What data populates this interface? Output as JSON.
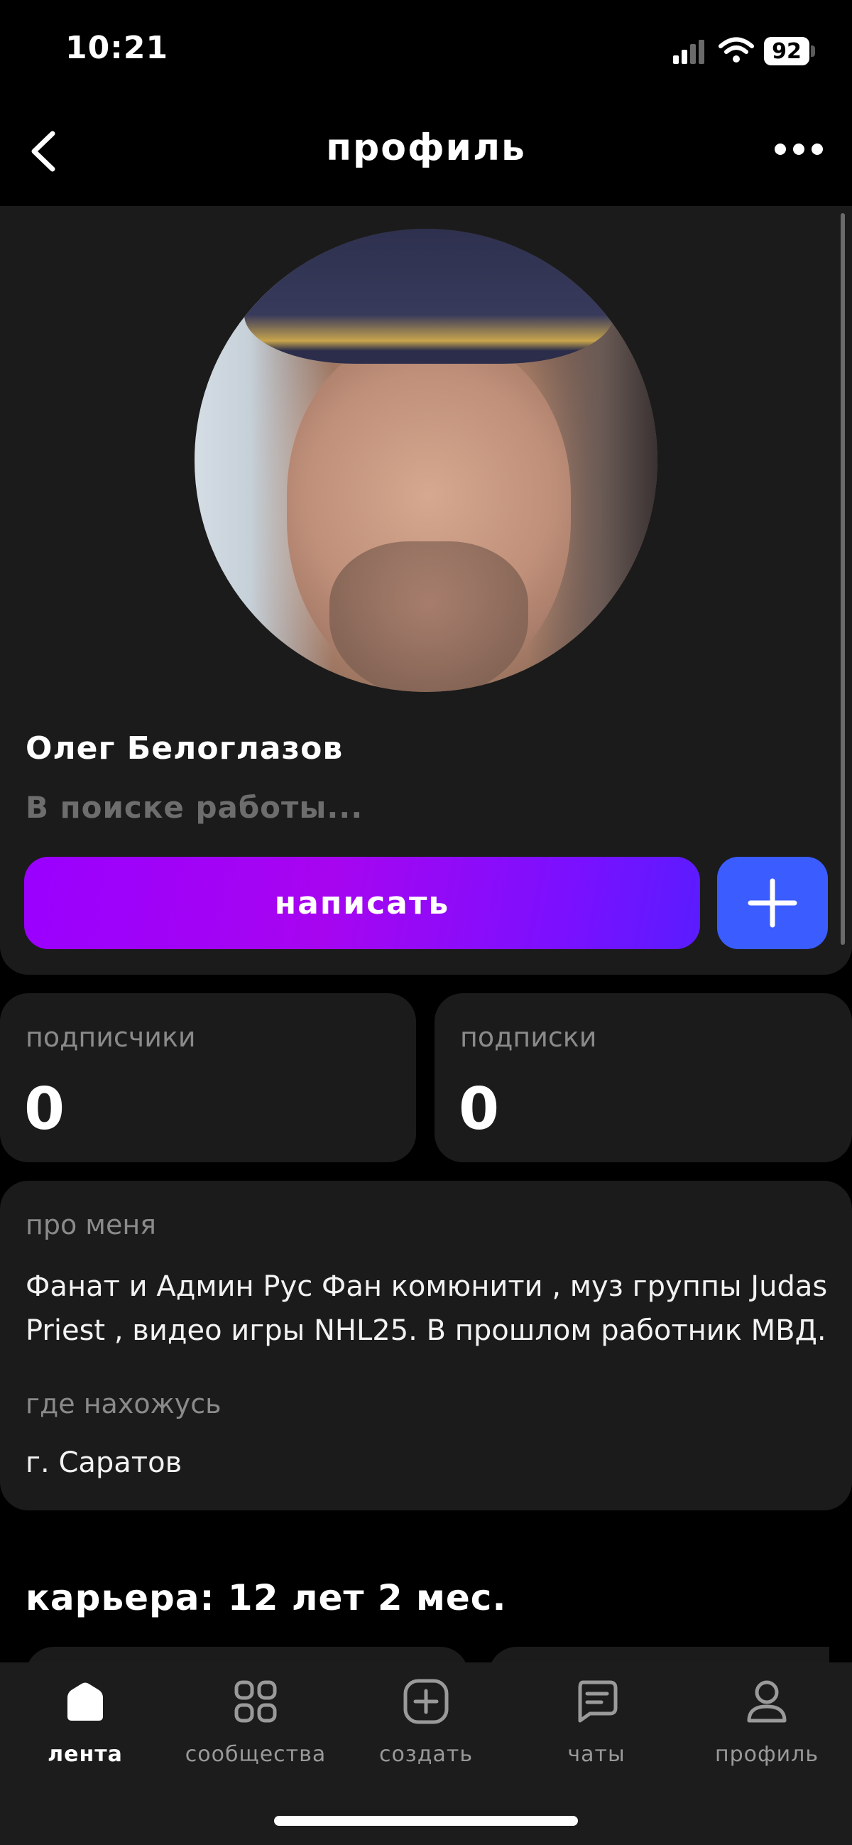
{
  "status_bar": {
    "time": "10:21",
    "battery": "92"
  },
  "header": {
    "title": "профиль"
  },
  "profile": {
    "name": "Олег Белоглазов",
    "status": "В поиске работы...",
    "write_label": "написать"
  },
  "stats": {
    "followers_label": "подписчики",
    "followers_value": "0",
    "following_label": "подписки",
    "following_value": "0"
  },
  "about": {
    "label": "про меня",
    "text": "Фанат и Админ Рус Фан комюнити , муз группы Judas Priest , видео игры NHL25. В прошлом работник МВД.",
    "location_label": "где нахожусь",
    "location": "г. Саратов"
  },
  "career": {
    "title": "карьера: 12 лет 2 мес."
  },
  "tabbar": {
    "items": [
      {
        "label": "лента",
        "icon": "home-icon",
        "active": true
      },
      {
        "label": "сообщества",
        "icon": "grid-icon",
        "active": false
      },
      {
        "label": "создать",
        "icon": "plus-square-icon",
        "active": false
      },
      {
        "label": "чаты",
        "icon": "chat-icon",
        "active": false
      },
      {
        "label": "профиль",
        "icon": "user-icon",
        "active": false
      }
    ]
  },
  "colors": {
    "accent_gradient_start": "#9a00ff",
    "accent_blue": "#3b5cff",
    "card_bg": "#1b1b1b",
    "muted_text": "#8a8a8a"
  }
}
